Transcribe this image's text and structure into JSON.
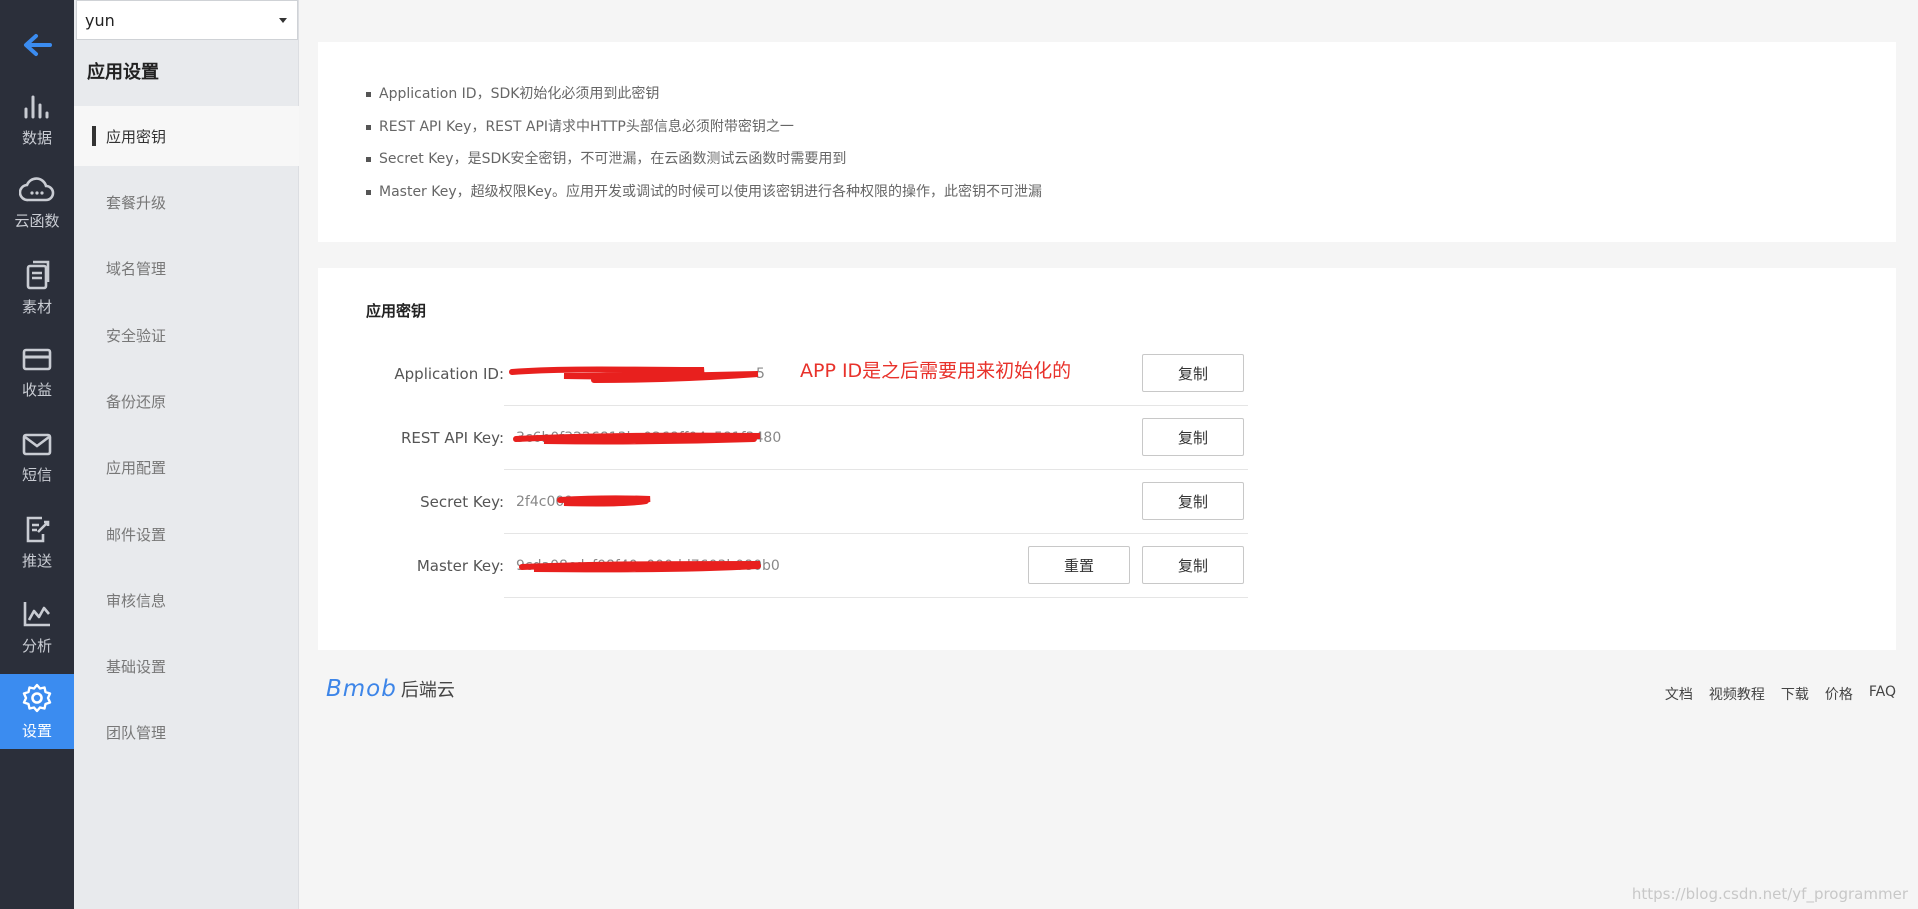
{
  "rail": {
    "items": [
      {
        "label": "数据",
        "icon": "bar-chart-icon"
      },
      {
        "label": "云函数",
        "icon": "cloud-icon"
      },
      {
        "label": "素材",
        "icon": "documents-icon"
      },
      {
        "label": "收益",
        "icon": "credit-card-icon"
      },
      {
        "label": "短信",
        "icon": "mail-icon"
      },
      {
        "label": "推送",
        "icon": "push-edit-icon"
      },
      {
        "label": "分析",
        "icon": "line-chart-icon"
      },
      {
        "label": "设置",
        "icon": "gear-icon",
        "active": true
      }
    ]
  },
  "sidebar": {
    "app_select": "yun",
    "title": "应用设置",
    "items": [
      {
        "label": "应用密钥",
        "active": true
      },
      {
        "label": "套餐升级"
      },
      {
        "label": "域名管理"
      },
      {
        "label": "安全验证"
      },
      {
        "label": "备份还原"
      },
      {
        "label": "应用配置"
      },
      {
        "label": "邮件设置"
      },
      {
        "label": "审核信息"
      },
      {
        "label": "基础设置"
      },
      {
        "label": "团队管理"
      }
    ]
  },
  "info": {
    "lines": [
      "Application ID，SDK初始化必须用到此密钥",
      "REST API Key，REST API请求中HTTP头部信息必须附带密钥之一",
      "Secret Key，是SDK安全密钥，不可泄漏，在云函数测试云函数时需要用到",
      "Master Key，超级权限Key。应用开发或调试的时候可以使用该密钥进行各种权限的操作，此密钥不可泄漏"
    ]
  },
  "keys": {
    "title": "应用密钥",
    "copy_label": "复制",
    "reset_label": "重置",
    "annotation": "APP ID是之后需要用来初始化的",
    "rows": [
      {
        "label": "Application ID:",
        "value": "5"
      },
      {
        "label": "REST API Key:",
        "value": "3c6b0f3226813bc0268ff04c581f3480"
      },
      {
        "label": "Secret Key:",
        "value": "2f4c009"
      },
      {
        "label": "Master Key:",
        "value": "9cda08cdcf08f40e000dd7603b080b0"
      }
    ]
  },
  "footer": {
    "logo": "Bmob",
    "logo_suffix": "后端云",
    "links": [
      "文档",
      "视频教程",
      "下载",
      "价格",
      "FAQ"
    ]
  },
  "watermark": "https://blog.csdn.net/yf_programmer",
  "colors": {
    "accent": "#3b8cf0",
    "annotation": "#e8322b",
    "redaction": "#e8201e"
  }
}
